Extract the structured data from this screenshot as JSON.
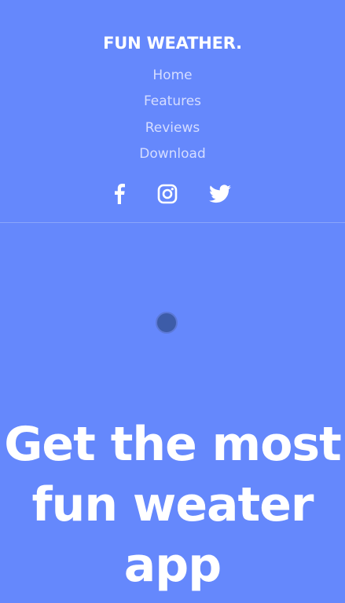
{
  "header": {
    "brand": "FUN WEATHER.",
    "nav": [
      {
        "label": "Home"
      },
      {
        "label": "Features"
      },
      {
        "label": "Reviews"
      },
      {
        "label": "Download"
      }
    ],
    "social_icons": [
      "facebook-icon",
      "instagram-icon",
      "twitter-icon"
    ]
  },
  "hero": {
    "title": "Get the most fun weater app"
  },
  "colors": {
    "background": "#6588fc",
    "nav_text": "#d5ddff",
    "title_text": "#ffffff",
    "loader": "#3d5ca8"
  }
}
